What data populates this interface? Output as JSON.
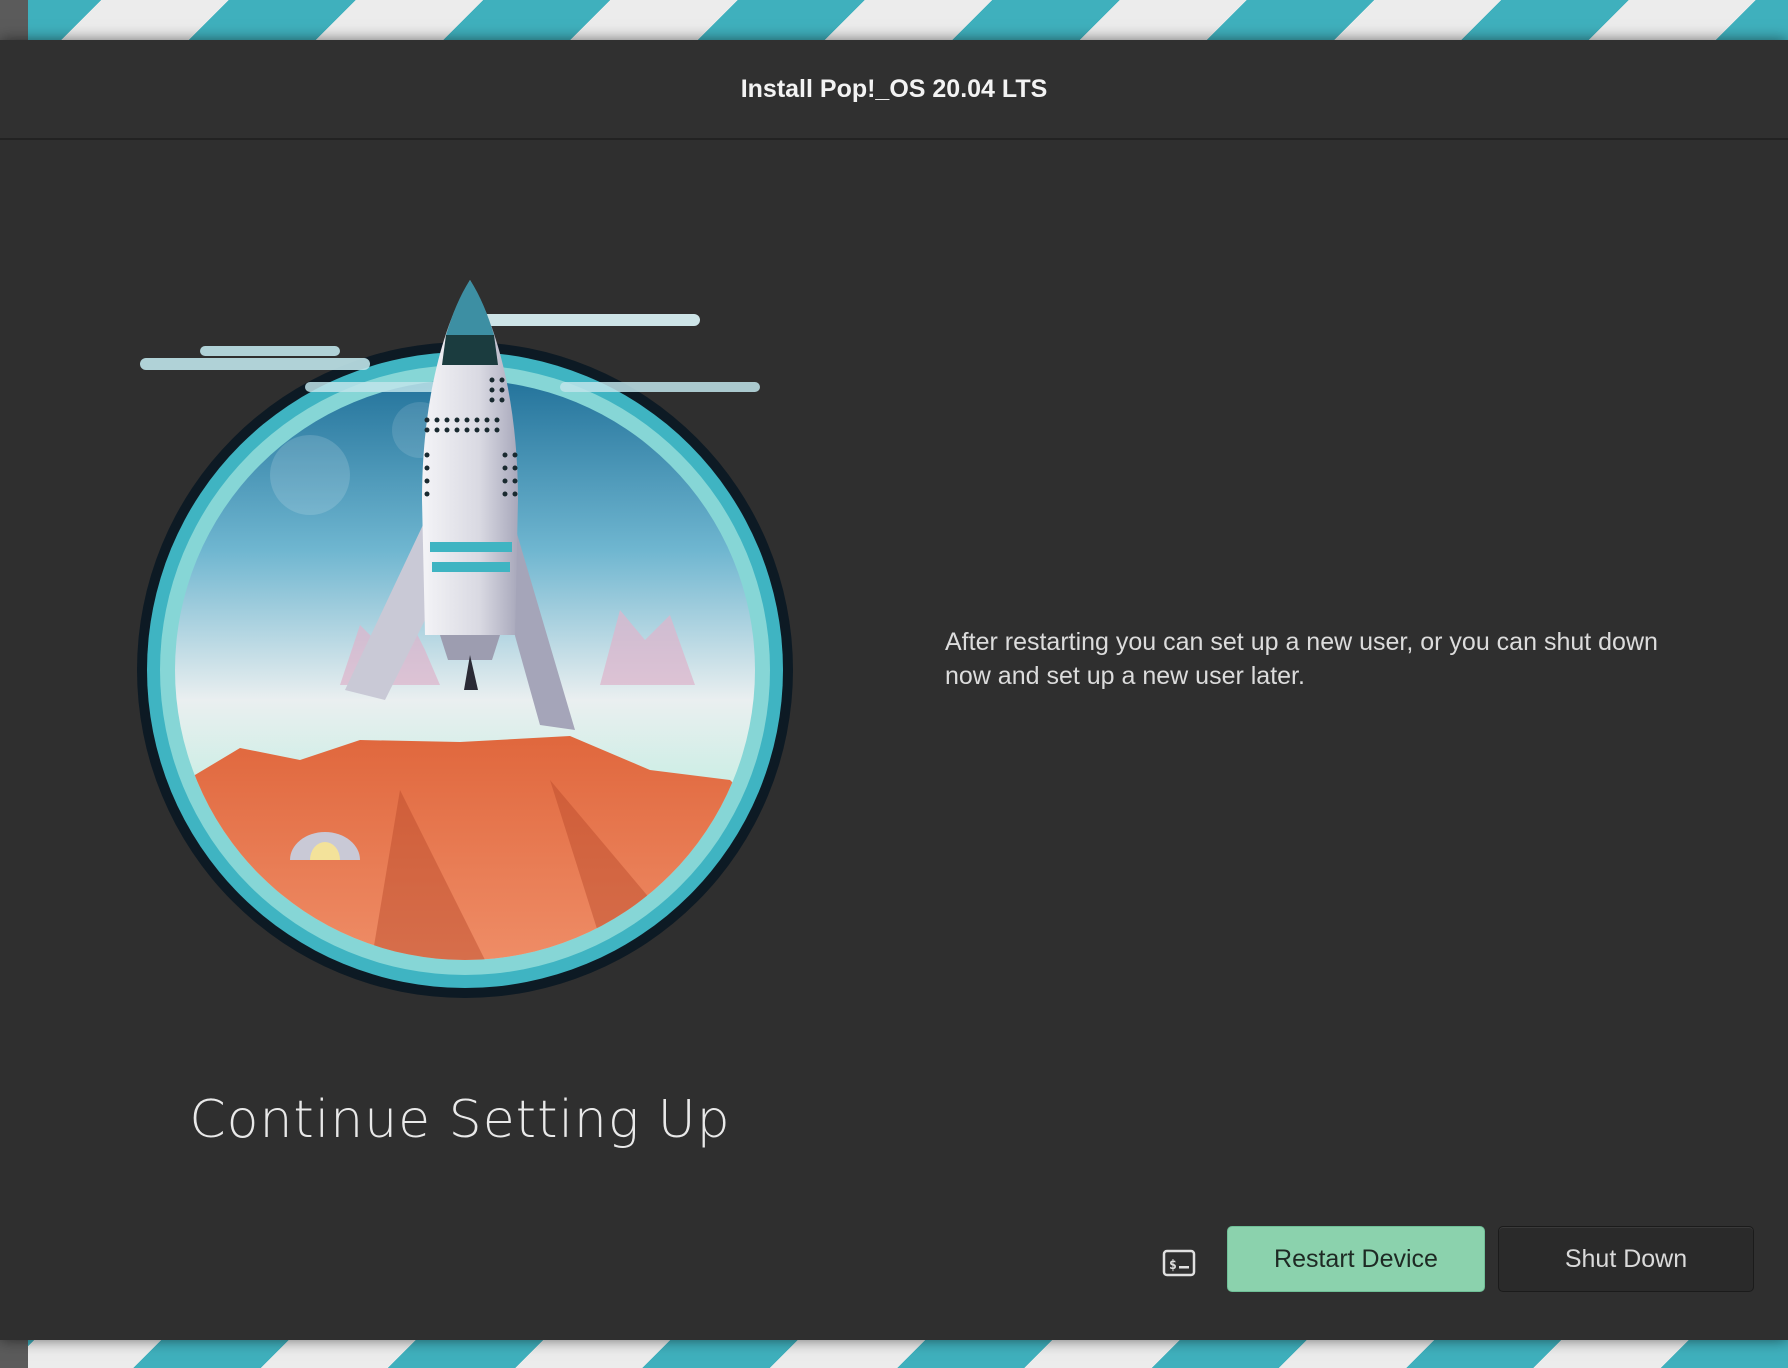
{
  "window": {
    "title": "Install Pop!_OS 20.04 LTS"
  },
  "main": {
    "heading": "Continue Setting Up",
    "description": "After restarting you can set up a new user, or you can shut down now and set up a new user later."
  },
  "actions": {
    "terminal_icon": "terminal-icon",
    "restart_label": "Restart Device",
    "shutdown_label": "Shut Down"
  },
  "colors": {
    "window_bg": "#2f2f2f",
    "accent_green": "#8bd2ad",
    "desktop_teal": "#3fb0bd"
  }
}
